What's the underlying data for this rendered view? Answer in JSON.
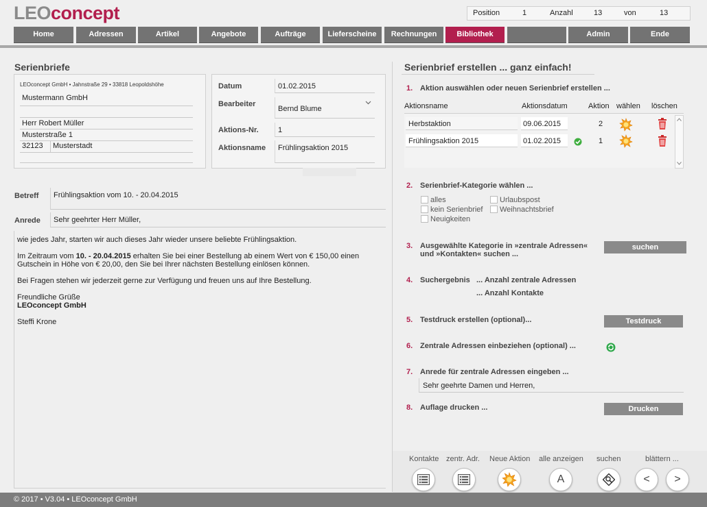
{
  "logo": {
    "part1": "LEO",
    "part2": "concept"
  },
  "position_bar": {
    "position_label": "Position",
    "position_value": "1",
    "anzahl_label": "Anzahl",
    "anzahl_value": "13",
    "von_label": "von",
    "von_value": "13"
  },
  "nav": {
    "items": [
      "Home",
      "Adressen",
      "Artikel",
      "Angebote",
      "Aufträge",
      "Lieferscheine",
      "Rechnungen",
      "Bibliothek",
      "",
      "Admin",
      "Ende"
    ],
    "active": "Bibliothek"
  },
  "left": {
    "title": "Serienbriefe",
    "sender_line": "LEOconcept GmbH • Jahnstraße 29 • 33818 Leopoldshöhe",
    "address": {
      "company": "Mustermann GmbH",
      "line2": "",
      "name": "Herr Robert Müller",
      "street": "Musterstraße 1",
      "zip": "32123",
      "city": "Musterstadt"
    },
    "meta": {
      "datum_label": "Datum",
      "datum_value": "01.02.2015",
      "bearbeiter_label": "Bearbeiter",
      "bearbeiter_value": "Bernd Blume",
      "aktionsnr_label": "Aktions-Nr.",
      "aktionsnr_value": "1",
      "aktionsname_label": "Aktionsname",
      "aktionsname_value": "Frühlingsaktion 2015"
    },
    "betreff_label": "Betreff",
    "betreff_value": "Frühlingsaktion vom 10. - 20.04.2015",
    "anrede_label": "Anrede",
    "anrede_value": "Sehr geehrter Herr Müller,",
    "body": {
      "p1": "wie jedes Jahr, starten wir auch dieses Jahr wieder unsere beliebte Frühlingsaktion.",
      "p2_pre": "Im Zeitraum vom ",
      "p2_bold": "10. - 20.04.2015",
      "p2_post": " erhalten Sie bei einer Bestellung ab einem Wert von € 150,00 einen Gutschein in Höhe von € 20,00, den Sie bei Ihrer nächsten Bestellung einlösen können.",
      "p3": "Bei Fragen stehen wir jederzeit gerne zur Verfügung und freuen uns auf Ihre Bestellung.",
      "greeting": "Freundliche Grüße",
      "company": "LEOconcept GmbH",
      "signature": "Steffi Krone"
    }
  },
  "right": {
    "title": "Serienbrief erstellen ... ganz einfach!",
    "step1": {
      "num": "1.",
      "label": "Aktion auswählen oder neuen Serienbrief erstellen ..."
    },
    "table": {
      "headers": [
        "Aktionsname",
        "Aktionsdatum",
        "Aktion",
        "wählen",
        "löschen"
      ],
      "rows": [
        {
          "name": "Herbstaktion",
          "date": "09.06.2015",
          "nr": "2",
          "checked": false
        },
        {
          "name": "Frühlingsaktion 2015",
          "date": "01.02.2015",
          "nr": "1",
          "checked": true
        }
      ]
    },
    "step2": {
      "num": "2.",
      "label": "Serienbrief-Kategorie wählen ..."
    },
    "categories": [
      "alles",
      "Urlaubspost",
      "kein Serienbrief",
      "Weihnachtsbrief",
      "Neuigkeiten"
    ],
    "step3": {
      "num": "3.",
      "label1": "Ausgewählte Kategorie in »zentrale Adressen«",
      "label2": "und »Kontakten« suchen ...",
      "button": "suchen"
    },
    "step4": {
      "num": "4.",
      "label": "Suchergebnis",
      "result1": "... Anzahl zentrale Adressen",
      "result2": "... Anzahl Kontakte"
    },
    "step5": {
      "num": "5.",
      "label": "Testdruck erstellen (optional)...",
      "button": "Testdruck"
    },
    "step6": {
      "num": "6.",
      "label": "Zentrale Adressen einbeziehen (optional) ..."
    },
    "step7": {
      "num": "7.",
      "label": "Anrede für zentrale Adressen eingeben ...",
      "value": "Sehr geehrte Damen und Herren,"
    },
    "step8": {
      "num": "8.",
      "label": "Auflage drucken ...",
      "button": "Drucken"
    }
  },
  "toolbar": {
    "labels": [
      "Kontakte",
      "zentr. Adr.",
      "Neue Aktion",
      "alle anzeigen",
      "suchen",
      "blättern ..."
    ],
    "a_glyph": "A",
    "prev_glyph": "<",
    "next_glyph": ">"
  },
  "footer": "© 2017 • V3.04 • LEOconcept GmbH",
  "colors": {
    "brand": "#b21f4e",
    "nav_gray": "#737373",
    "button_gray": "#8a8a8a"
  }
}
